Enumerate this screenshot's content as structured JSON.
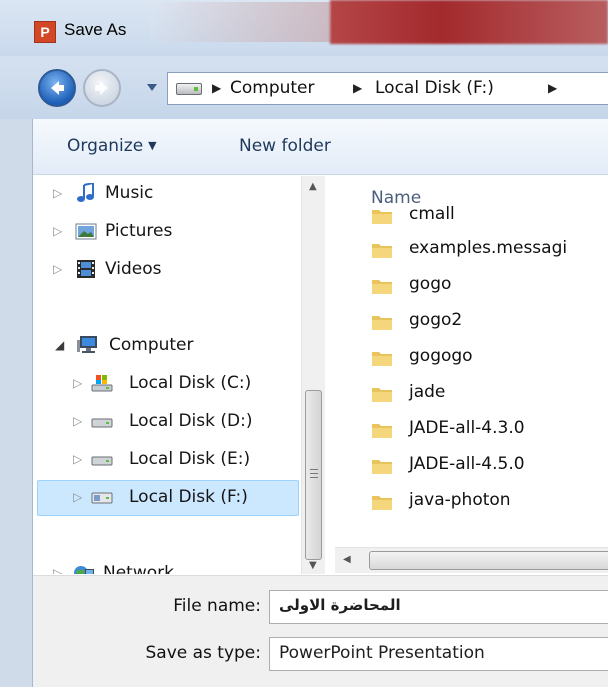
{
  "window": {
    "title": "Save As"
  },
  "address": {
    "crumbs": [
      "Computer",
      "Local Disk (F:)"
    ]
  },
  "toolbar": {
    "organize_label": "Organize",
    "new_folder_label": "New folder"
  },
  "nav_tree": [
    {
      "label": "Music",
      "icon": "music-icon",
      "expander": "collapsed"
    },
    {
      "label": "Pictures",
      "icon": "pictures-icon",
      "expander": "collapsed"
    },
    {
      "label": "Videos",
      "icon": "videos-icon",
      "expander": "collapsed"
    },
    {
      "label": "Computer",
      "icon": "computer-icon",
      "expander": "expanded"
    },
    {
      "label": "Local Disk (C:)",
      "icon": "system-drive-icon",
      "expander": "collapsed"
    },
    {
      "label": "Local Disk (D:)",
      "icon": "drive-icon",
      "expander": "collapsed"
    },
    {
      "label": "Local Disk (E:)",
      "icon": "drive-icon",
      "expander": "collapsed"
    },
    {
      "label": "Local Disk (F:)",
      "icon": "drive-icon",
      "expander": "collapsed",
      "selected": true
    },
    {
      "label": "Network",
      "icon": "network-icon",
      "expander": "collapsed"
    }
  ],
  "file_list": {
    "column_name": "Name",
    "items": [
      "cmall",
      "examples.messagi",
      "gogo",
      "gogo2",
      "gogogo",
      "jade",
      "JADE-all-4.3.0",
      "JADE-all-4.5.0",
      "java-photon"
    ]
  },
  "form": {
    "file_name_label": "File name:",
    "file_name_value": "المحاضرة الاولى",
    "save_type_label": "Save as type:",
    "save_type_value": "PowerPoint Presentation"
  },
  "colors": {
    "selection": "#cce8ff",
    "toolbar_text": "#1e395b",
    "app_icon": "#d24726"
  }
}
